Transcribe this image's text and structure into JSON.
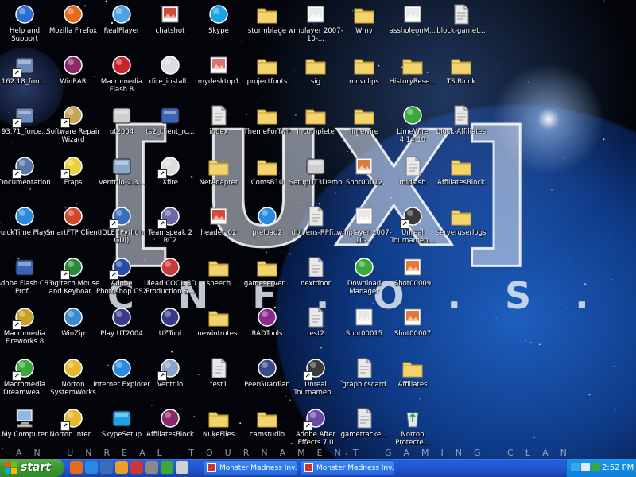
{
  "desktop": {
    "logo": {
      "bracket_left": "[",
      "text": "UX",
      "bracket_right": "]",
      "sub": "CNF.O.S."
    },
    "tagline": "AN UNREAL TOURNAMENT GAMING CLAN",
    "icons": [
      {
        "label": "Help and Support",
        "icon": "help-icon",
        "color": "#2a6fd6",
        "shortcut": false,
        "col": 0,
        "row": 0
      },
      {
        "label": "Mozilla Firefox",
        "icon": "firefox-icon",
        "color": "#e66a1c",
        "shortcut": false,
        "col": 1,
        "row": 0
      },
      {
        "label": "RealPlayer",
        "icon": "realplayer-icon",
        "color": "#4aa3e8",
        "shortcut": false,
        "col": 2,
        "row": 0
      },
      {
        "label": "chatshot",
        "icon": "image-file-icon",
        "color": "#d24a3a",
        "shortcut": false,
        "col": 3,
        "row": 0
      },
      {
        "label": "Skype",
        "icon": "skype-icon",
        "color": "#1aa3e6",
        "shortcut": false,
        "col": 4,
        "row": 0
      },
      {
        "label": "stormblade",
        "icon": "folder-icon",
        "color": "#f3d36b",
        "shortcut": false,
        "col": 5,
        "row": 0
      },
      {
        "label": "wmplayer 2007-10-...",
        "icon": "image-file-icon",
        "color": "#e8e8e8",
        "shortcut": false,
        "col": 6,
        "row": 0
      },
      {
        "label": "Wmv",
        "icon": "folder-icon",
        "color": "#f3d36b",
        "shortcut": false,
        "col": 7,
        "row": 0
      },
      {
        "label": "assholeonM...",
        "icon": "image-file-icon",
        "color": "#e8e8e8",
        "shortcut": false,
        "col": 8,
        "row": 0
      },
      {
        "label": "block-gamet...",
        "icon": "text-file-icon",
        "color": "#e8e8e8",
        "shortcut": false,
        "col": 9,
        "row": 0
      },
      {
        "label": "162.18_forc...",
        "icon": "shortcut-icon",
        "color": "#6a88b8",
        "shortcut": true,
        "col": 0,
        "row": 1
      },
      {
        "label": "WinRAR",
        "icon": "winrar-icon",
        "color": "#8b2a6b",
        "shortcut": false,
        "col": 1,
        "row": 1
      },
      {
        "label": "Macromedia Flash 8",
        "icon": "flash-icon",
        "color": "#c8242a",
        "shortcut": false,
        "col": 2,
        "row": 1
      },
      {
        "label": "xfire_install...",
        "icon": "xfire-icon",
        "color": "#dddddd",
        "shortcut": false,
        "col": 3,
        "row": 1
      },
      {
        "label": "mydesktop1",
        "icon": "image-file-icon",
        "color": "#e07070",
        "shortcut": false,
        "col": 4,
        "row": 1
      },
      {
        "label": "projectfonts",
        "icon": "folder-icon",
        "color": "#f3d36b",
        "shortcut": false,
        "col": 5,
        "row": 1
      },
      {
        "label": "sig",
        "icon": "folder-icon",
        "color": "#f3d36b",
        "shortcut": false,
        "col": 6,
        "row": 1
      },
      {
        "label": "movclips",
        "icon": "folder-icon",
        "color": "#f3d36b",
        "shortcut": false,
        "col": 7,
        "row": 1
      },
      {
        "label": "HistoryRese...",
        "icon": "folder-icon",
        "color": "#f3d36b",
        "shortcut": false,
        "col": 8,
        "row": 1
      },
      {
        "label": "TS Block",
        "icon": "folder-icon",
        "color": "#f3d36b",
        "shortcut": false,
        "col": 9,
        "row": 1
      },
      {
        "label": "93.71_force...",
        "icon": "shortcut-icon",
        "color": "#6a88b8",
        "shortcut": true,
        "col": 0,
        "row": 2
      },
      {
        "label": "Software Repair Wizard",
        "icon": "wizard-icon",
        "color": "#c9a55a",
        "shortcut": true,
        "col": 1,
        "row": 2
      },
      {
        "label": "ut2004",
        "icon": "app-icon",
        "color": "#cfcfcf",
        "shortcut": false,
        "col": 2,
        "row": 2
      },
      {
        "label": "ts2_client_rc...",
        "icon": "installer-icon",
        "color": "#3a64b8",
        "shortcut": false,
        "col": 3,
        "row": 2
      },
      {
        "label": "index",
        "icon": "web-file-icon",
        "color": "#e8e8e8",
        "shortcut": false,
        "col": 4,
        "row": 2
      },
      {
        "label": "ThemeForTwit",
        "icon": "folder-icon",
        "color": "#f3d36b",
        "shortcut": false,
        "col": 5,
        "row": 2
      },
      {
        "label": "Incomplete",
        "icon": "folder-icon",
        "color": "#f3d36b",
        "shortcut": false,
        "col": 6,
        "row": 2
      },
      {
        "label": "limewire",
        "icon": "folder-icon",
        "color": "#f3d36b",
        "shortcut": false,
        "col": 7,
        "row": 2
      },
      {
        "label": "LimeWire 4.14.10",
        "icon": "limewire-icon",
        "color": "#3aa83a",
        "shortcut": false,
        "col": 8,
        "row": 2
      },
      {
        "label": "block-Affiliates",
        "icon": "text-file-icon",
        "color": "#e8e8e8",
        "shortcut": false,
        "col": 9,
        "row": 2
      },
      {
        "label": "Documentation",
        "icon": "documentation-icon",
        "color": "#5a77a8",
        "shortcut": true,
        "col": 0,
        "row": 3
      },
      {
        "label": "Fraps",
        "icon": "fraps-icon",
        "color": "#e8d23a",
        "shortcut": true,
        "col": 1,
        "row": 3
      },
      {
        "label": "ventrilo-2.3...",
        "icon": "installer-icon",
        "color": "#8aa6c8",
        "shortcut": false,
        "col": 2,
        "row": 3
      },
      {
        "label": "Xfire",
        "icon": "xfire-icon",
        "color": "#dddddd",
        "shortcut": true,
        "col": 3,
        "row": 3
      },
      {
        "label": "NetAdapter",
        "icon": "folder-icon",
        "color": "#f3d36b",
        "shortcut": false,
        "col": 4,
        "row": 3
      },
      {
        "label": "ComsB10",
        "icon": "folder-icon",
        "color": "#f3d36b",
        "shortcut": false,
        "col": 5,
        "row": 3
      },
      {
        "label": "SetupUT3Demo",
        "icon": "app-icon",
        "color": "#cfcfcf",
        "shortcut": false,
        "col": 6,
        "row": 3
      },
      {
        "label": "Shot00012",
        "icon": "image-file-icon",
        "color": "#e07a3a",
        "shortcut": false,
        "col": 7,
        "row": 3
      },
      {
        "label": "mlds.sh",
        "icon": "text-file-icon",
        "color": "#e8e8e8",
        "shortcut": false,
        "col": 8,
        "row": 3
      },
      {
        "label": "AffiliatesBlock",
        "icon": "folder-icon",
        "color": "#f3d36b",
        "shortcut": false,
        "col": 9,
        "row": 3
      },
      {
        "label": "QuickTime Player",
        "icon": "quicktime-icon",
        "color": "#2a8ae0",
        "shortcut": false,
        "col": 0,
        "row": 4
      },
      {
        "label": "SmartFTP Client",
        "icon": "smartftp-icon",
        "color": "#d04a2a",
        "shortcut": false,
        "col": 1,
        "row": 4
      },
      {
        "label": "IDLE (Python GUI)",
        "icon": "python-icon",
        "color": "#3a6eb8",
        "shortcut": true,
        "col": 2,
        "row": 4
      },
      {
        "label": "Teamspeak 2 RC2",
        "icon": "teamspeak-icon",
        "color": "#6a6aa8",
        "shortcut": true,
        "col": 3,
        "row": 4
      },
      {
        "label": "header_02",
        "icon": "png-file-icon",
        "color": "#d84a3a",
        "shortcut": false,
        "col": 4,
        "row": 4
      },
      {
        "label": "preload2",
        "icon": "ie-file-icon",
        "color": "#2a8ae0",
        "shortcut": false,
        "col": 5,
        "row": 4
      },
      {
        "label": "dbivens-RPfi...",
        "icon": "document-icon",
        "color": "#e8e8e8",
        "shortcut": false,
        "col": 6,
        "row": 4
      },
      {
        "label": "wmplayer 2007-10-...",
        "icon": "image-file-icon",
        "color": "#e8e8e8",
        "shortcut": false,
        "col": 7,
        "row": 4
      },
      {
        "label": "Unreal Tournamen...",
        "icon": "unreal-icon",
        "color": "#3a3a3a",
        "shortcut": true,
        "col": 8,
        "row": 4
      },
      {
        "label": "serveruserlogs",
        "icon": "folder-icon",
        "color": "#f3d36b",
        "shortcut": false,
        "col": 9,
        "row": 4
      },
      {
        "label": "Adobe Flash CS3 Prof...",
        "icon": "window-icon",
        "color": "#3a64b8",
        "shortcut": false,
        "col": 0,
        "row": 5
      },
      {
        "label": "Logitech Mouse and Keyboar...",
        "icon": "logitech-icon",
        "color": "#2a8a3a",
        "shortcut": true,
        "col": 1,
        "row": 5
      },
      {
        "label": "Adobe Photoshop CS2",
        "icon": "photoshop-icon",
        "color": "#2a4aa8",
        "shortcut": true,
        "col": 2,
        "row": 5
      },
      {
        "label": "Ulead COOL 3D Production S...",
        "icon": "ulead-icon",
        "color": "#c83a3a",
        "shortcut": false,
        "col": 3,
        "row": 5
      },
      {
        "label": "speech",
        "icon": "folder-icon",
        "color": "#f3d36b",
        "shortcut": false,
        "col": 4,
        "row": 5
      },
      {
        "label": "gameserver...",
        "icon": "folder-icon",
        "color": "#f3d36b",
        "shortcut": false,
        "col": 5,
        "row": 5
      },
      {
        "label": "nextdoor",
        "icon": "text-file-icon",
        "color": "#e8e8e8",
        "shortcut": false,
        "col": 6,
        "row": 5
      },
      {
        "label": "Download Manager",
        "icon": "download-icon",
        "color": "#3aa83a",
        "shortcut": false,
        "col": 7,
        "row": 5
      },
      {
        "label": "Shot00009",
        "icon": "image-file-icon",
        "color": "#e07a3a",
        "shortcut": false,
        "col": 8,
        "row": 5
      },
      {
        "label": "Macromedia Fireworks 8",
        "icon": "fireworks-icon",
        "color": "#c8a02a",
        "shortcut": true,
        "col": 0,
        "row": 6
      },
      {
        "label": "WinZip",
        "icon": "winzip-icon",
        "color": "#3a8ad0",
        "shortcut": false,
        "col": 1,
        "row": 6
      },
      {
        "label": "Play UT2004",
        "icon": "unreal-icon",
        "color": "#3a3a8a",
        "shortcut": false,
        "col": 2,
        "row": 6
      },
      {
        "label": "UZTool",
        "icon": "unreal-icon",
        "color": "#3a3a8a",
        "shortcut": false,
        "col": 3,
        "row": 6
      },
      {
        "label": "newintrotest",
        "icon": "folder-icon",
        "color": "#f3d36b",
        "shortcut": false,
        "col": 4,
        "row": 6
      },
      {
        "label": "RADTools",
        "icon": "radtools-icon",
        "color": "#8a2a8a",
        "shortcut": false,
        "col": 5,
        "row": 6
      },
      {
        "label": "test2",
        "icon": "web-file-icon",
        "color": "#e8e8e8",
        "shortcut": false,
        "col": 6,
        "row": 6
      },
      {
        "label": "Shot00015",
        "icon": "image-file-icon",
        "color": "#e8e8e8",
        "shortcut": false,
        "col": 7,
        "row": 6
      },
      {
        "label": "Shot00007",
        "icon": "image-file-icon",
        "color": "#e07a3a",
        "shortcut": false,
        "col": 8,
        "row": 6
      },
      {
        "label": "Macromedia Dreamwea...",
        "icon": "dreamweaver-icon",
        "color": "#3aa83a",
        "shortcut": true,
        "col": 0,
        "row": 7
      },
      {
        "label": "Norton SystemWorks",
        "icon": "norton-icon",
        "color": "#e8b82a",
        "shortcut": false,
        "col": 1,
        "row": 7
      },
      {
        "label": "Internet Explorer",
        "icon": "ie-icon",
        "color": "#2a8ae0",
        "shortcut": false,
        "col": 2,
        "row": 7
      },
      {
        "label": "Ventrilo",
        "icon": "ventrilo-icon",
        "color": "#8aa6c8",
        "shortcut": true,
        "col": 3,
        "row": 7
      },
      {
        "label": "test1",
        "icon": "text-file-icon",
        "color": "#e8e8e8",
        "shortcut": false,
        "col": 4,
        "row": 7
      },
      {
        "label": "PeerGuardian",
        "icon": "peerguardian-icon",
        "color": "#3a4a8a",
        "shortcut": false,
        "col": 5,
        "row": 7
      },
      {
        "label": "Unreal Tournamen...",
        "icon": "unreal-icon",
        "color": "#3a3a3a",
        "shortcut": true,
        "col": 6,
        "row": 7
      },
      {
        "label": "graphicscard",
        "icon": "text-file-icon",
        "color": "#e8e8e8",
        "shortcut": false,
        "col": 7,
        "row": 7
      },
      {
        "label": "Affiliates",
        "icon": "folder-icon",
        "color": "#f3d36b",
        "shortcut": false,
        "col": 8,
        "row": 7
      },
      {
        "label": "My Computer",
        "icon": "my-computer-icon",
        "color": "#8ab8e8",
        "shortcut": false,
        "col": 0,
        "row": 8
      },
      {
        "label": "Norton Inter...",
        "icon": "norton-icon",
        "color": "#e8b82a",
        "shortcut": true,
        "col": 1,
        "row": 8
      },
      {
        "label": "SkypeSetup",
        "icon": "installer-icon",
        "color": "#1aa3e6",
        "shortcut": false,
        "col": 2,
        "row": 8
      },
      {
        "label": "AffiliatesBlock",
        "icon": "winrar-icon",
        "color": "#8b2a6b",
        "shortcut": false,
        "col": 3,
        "row": 8
      },
      {
        "label": "NukeFiles",
        "icon": "folder-icon",
        "color": "#f3d36b",
        "shortcut": false,
        "col": 4,
        "row": 8
      },
      {
        "label": "camstudio",
        "icon": "folder-icon",
        "color": "#f3d36b",
        "shortcut": false,
        "col": 5,
        "row": 8
      },
      {
        "label": "Adobe After Effects 7.0",
        "icon": "aftereffects-icon",
        "color": "#6a4aa8",
        "shortcut": true,
        "col": 6,
        "row": 8
      },
      {
        "label": "gametracke...",
        "icon": "text-file-icon",
        "color": "#e8e8e8",
        "shortcut": false,
        "col": 7,
        "row": 8
      },
      {
        "label": "Norton Protecte...",
        "icon": "recycle-bin-icon",
        "color": "#3aa83a",
        "shortcut": false,
        "col": 8,
        "row": 8
      }
    ]
  },
  "taskbar": {
    "start_label": "start",
    "quick_launch": [
      {
        "icon": "firefox-icon",
        "color": "#e66a1c"
      },
      {
        "icon": "ie-icon",
        "color": "#2a8ae0"
      },
      {
        "icon": "show-desktop-icon",
        "color": "#3a6eb8"
      },
      {
        "icon": "media-player-icon",
        "color": "#e8a02a"
      },
      {
        "icon": "app-icon",
        "color": "#c83a3a"
      },
      {
        "icon": "app-icon",
        "color": "#8a8a8a"
      },
      {
        "icon": "app-icon",
        "color": "#3aa83a"
      },
      {
        "icon": "app-icon",
        "color": "#d0d0d0"
      }
    ],
    "tasks": [
      {
        "label": "Monster Madness Inv..."
      },
      {
        "label": "Monster Madness Inv..."
      }
    ],
    "tray_icons": [
      {
        "icon": "network-icon",
        "color": "#3aa8e8"
      },
      {
        "icon": "volume-icon",
        "color": "#e8e8e8"
      },
      {
        "icon": "security-icon",
        "color": "#3aa83a"
      }
    ],
    "clock": "2:52 PM"
  }
}
